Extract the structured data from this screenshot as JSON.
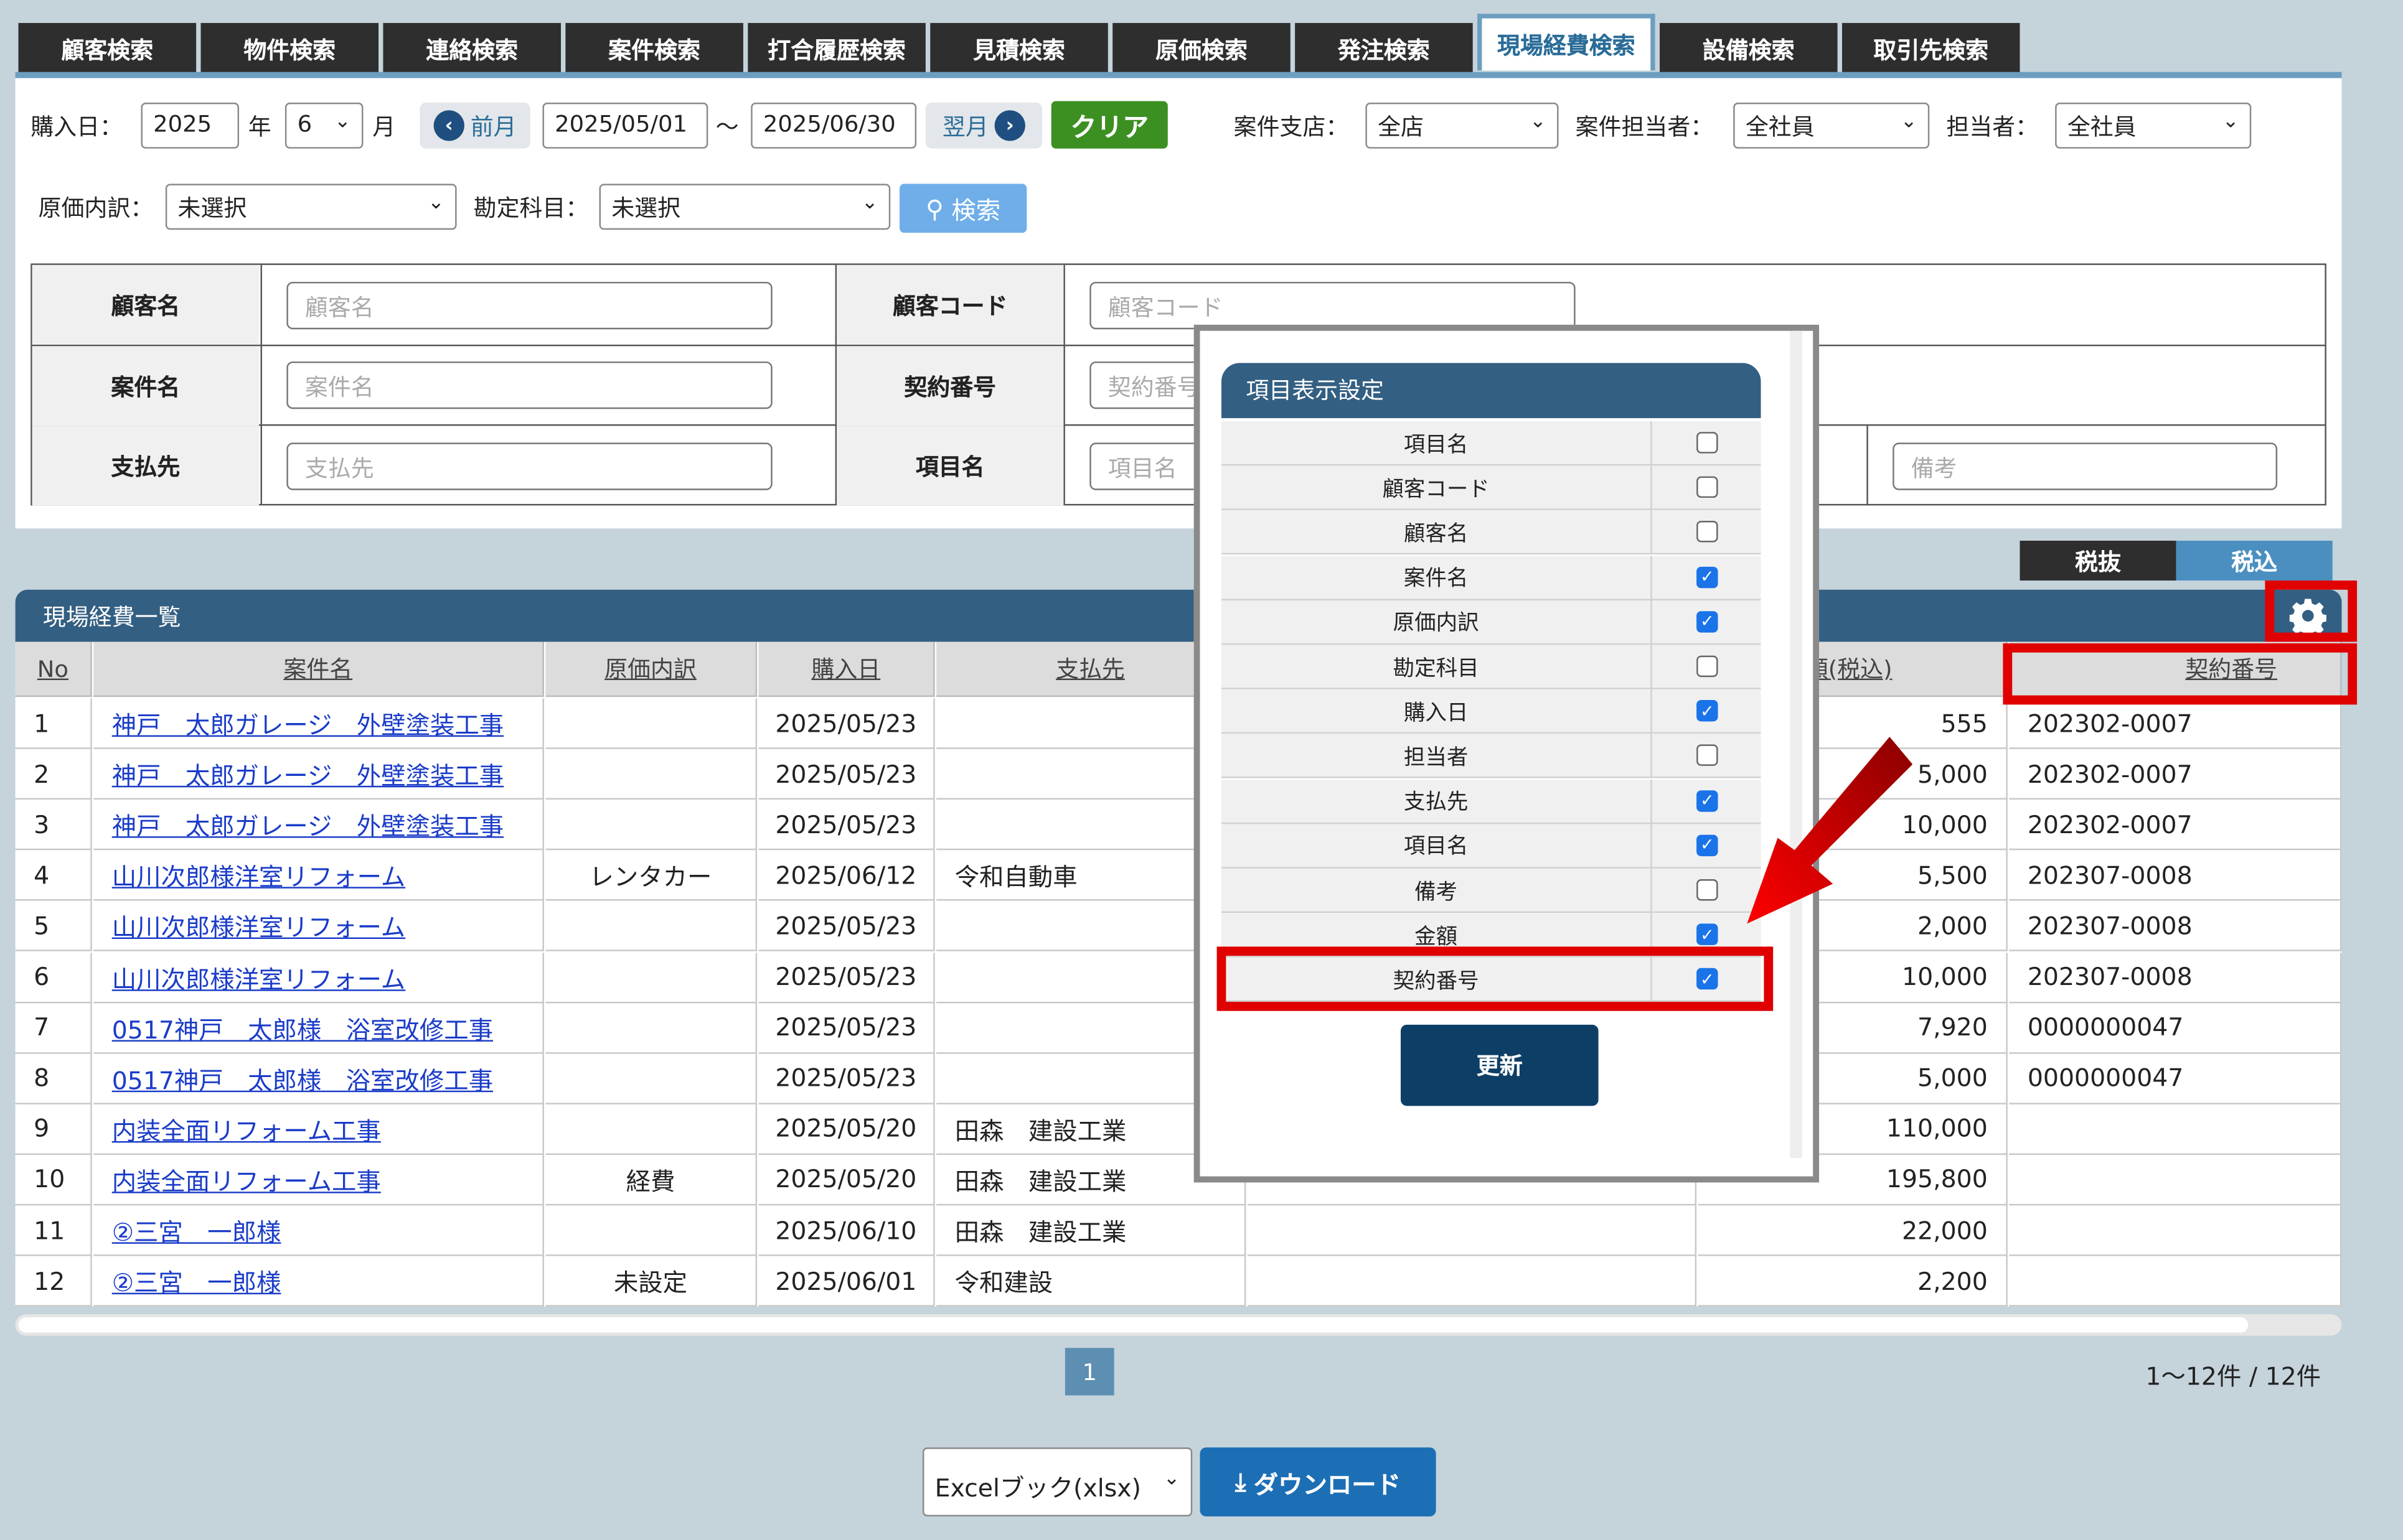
{
  "tabs": [
    "顧客検索",
    "物件検索",
    "連絡検索",
    "案件検索",
    "打合履歴検索",
    "見積検索",
    "原価検索",
    "発注検索",
    "現場経費検索",
    "設備検索",
    "取引先検索"
  ],
  "filters": {
    "purchase_label": "購入日：",
    "year": "2025",
    "year_unit": "年",
    "month": "6",
    "month_unit": "月",
    "prev_label": "前月",
    "date_from": "2025/05/01",
    "tilde": "～",
    "date_to": "2025/06/30",
    "next_label": "翌月",
    "clear_label": "クリア",
    "branch_label": "案件支店：",
    "branch_value": "全店",
    "case_staff_label": "案件担当者：",
    "case_staff_value": "全社員",
    "staff_label": "担当者：",
    "staff_value": "全社員",
    "cost_label": "原価内訳：",
    "cost_value": "未選択",
    "account_label": "勘定科目：",
    "account_value": "未選択",
    "search_label": "検索"
  },
  "criteria": {
    "customer_name_label": "顧客名",
    "customer_name_ph": "顧客名",
    "customer_code_label": "顧客コード",
    "customer_code_ph": "顧客コード",
    "case_name_label": "案件名",
    "case_name_ph": "案件名",
    "contract_label": "契約番号",
    "contract_ph": "契約番号",
    "payee_label": "支払先",
    "payee_ph": "支払先",
    "item_label": "項目名",
    "item_ph": "項目名",
    "note_ph": "備考"
  },
  "tax": {
    "excl": "税抜",
    "incl": "税込"
  },
  "list": {
    "title": "現場経費一覧",
    "headers": {
      "no": "No",
      "case": "案件名",
      "cost": "原価内訳",
      "date": "購入日",
      "payee": "支払先",
      "amount": "額(税込)",
      "contract": "契約番号"
    },
    "rows": [
      {
        "no": "1",
        "case": "神戸　太郎ガレージ　外壁塗装工事",
        "cost": "",
        "date": "2025/05/23",
        "payee": "",
        "item": "",
        "amount": "555",
        "contract": "202302-0007"
      },
      {
        "no": "2",
        "case": "神戸　太郎ガレージ　外壁塗装工事",
        "cost": "",
        "date": "2025/05/23",
        "payee": "",
        "item": "",
        "amount": "5,000",
        "contract": "202302-0007"
      },
      {
        "no": "3",
        "case": "神戸　太郎ガレージ　外壁塗装工事",
        "cost": "",
        "date": "2025/05/23",
        "payee": "",
        "item": "",
        "amount": "10,000",
        "contract": "202302-0007"
      },
      {
        "no": "4",
        "case": "山川次郎様洋室リフォーム",
        "cost": "レンタカー",
        "date": "2025/06/12",
        "payee": "令和自動車",
        "item": "",
        "amount": "5,500",
        "contract": "202307-0008"
      },
      {
        "no": "5",
        "case": "山川次郎様洋室リフォーム",
        "cost": "",
        "date": "2025/05/23",
        "payee": "",
        "item": "",
        "amount": "2,000",
        "contract": "202307-0008"
      },
      {
        "no": "6",
        "case": "山川次郎様洋室リフォーム",
        "cost": "",
        "date": "2025/05/23",
        "payee": "",
        "item": "",
        "amount": "10,000",
        "contract": "202307-0008"
      },
      {
        "no": "7",
        "case": "0517神戸　太郎様　浴室改修工事",
        "cost": "",
        "date": "2025/05/23",
        "payee": "",
        "item": "",
        "amount": "7,920",
        "contract": "0000000047"
      },
      {
        "no": "8",
        "case": "0517神戸　太郎様　浴室改修工事",
        "cost": "",
        "date": "2025/05/23",
        "payee": "",
        "item": "",
        "amount": "5,000",
        "contract": "0000000047"
      },
      {
        "no": "9",
        "case": "内装全面リフォーム工事",
        "cost": "",
        "date": "2025/05/20",
        "payee": "田森　建設工業",
        "item": "",
        "amount": "110,000",
        "contract": ""
      },
      {
        "no": "10",
        "case": "内装全面リフォーム工事",
        "cost": "経費",
        "date": "2025/05/20",
        "payee": "田森　建設工業",
        "item": "",
        "amount": "195,800",
        "contract": ""
      },
      {
        "no": "11",
        "case": "②三宮　一郎様",
        "cost": "",
        "date": "2025/06/10",
        "payee": "田森　建設工業",
        "item": "",
        "amount": "22,000",
        "contract": ""
      },
      {
        "no": "12",
        "case": "②三宮　一郎様",
        "cost": "未設定",
        "date": "2025/06/01",
        "payee": "令和建設",
        "item": "",
        "amount": "2,200",
        "contract": ""
      }
    ]
  },
  "pagination": {
    "page": "1",
    "count": "1～12件 / 12件"
  },
  "download": {
    "format": "Excelブック(xlsx)",
    "button": "ダウンロード"
  },
  "modal": {
    "title": "項目表示設定",
    "items": [
      {
        "name": "項目名",
        "checked": false
      },
      {
        "name": "顧客コード",
        "checked": false
      },
      {
        "name": "顧客名",
        "checked": false
      },
      {
        "name": "案件名",
        "checked": true
      },
      {
        "name": "原価内訳",
        "checked": true
      },
      {
        "name": "勘定科目",
        "checked": false
      },
      {
        "name": "購入日",
        "checked": true
      },
      {
        "name": "担当者",
        "checked": false
      },
      {
        "name": "支払先",
        "checked": true
      },
      {
        "name": "項目名",
        "checked": true
      },
      {
        "name": "備考",
        "checked": false
      },
      {
        "name": "金額",
        "checked": true
      },
      {
        "name": "契約番号",
        "checked": true
      }
    ],
    "update": "更新"
  },
  "colors": {
    "header": "#335f82",
    "clear": "#3c8f21",
    "search": "#6faee9",
    "annotation": "#e00000"
  }
}
